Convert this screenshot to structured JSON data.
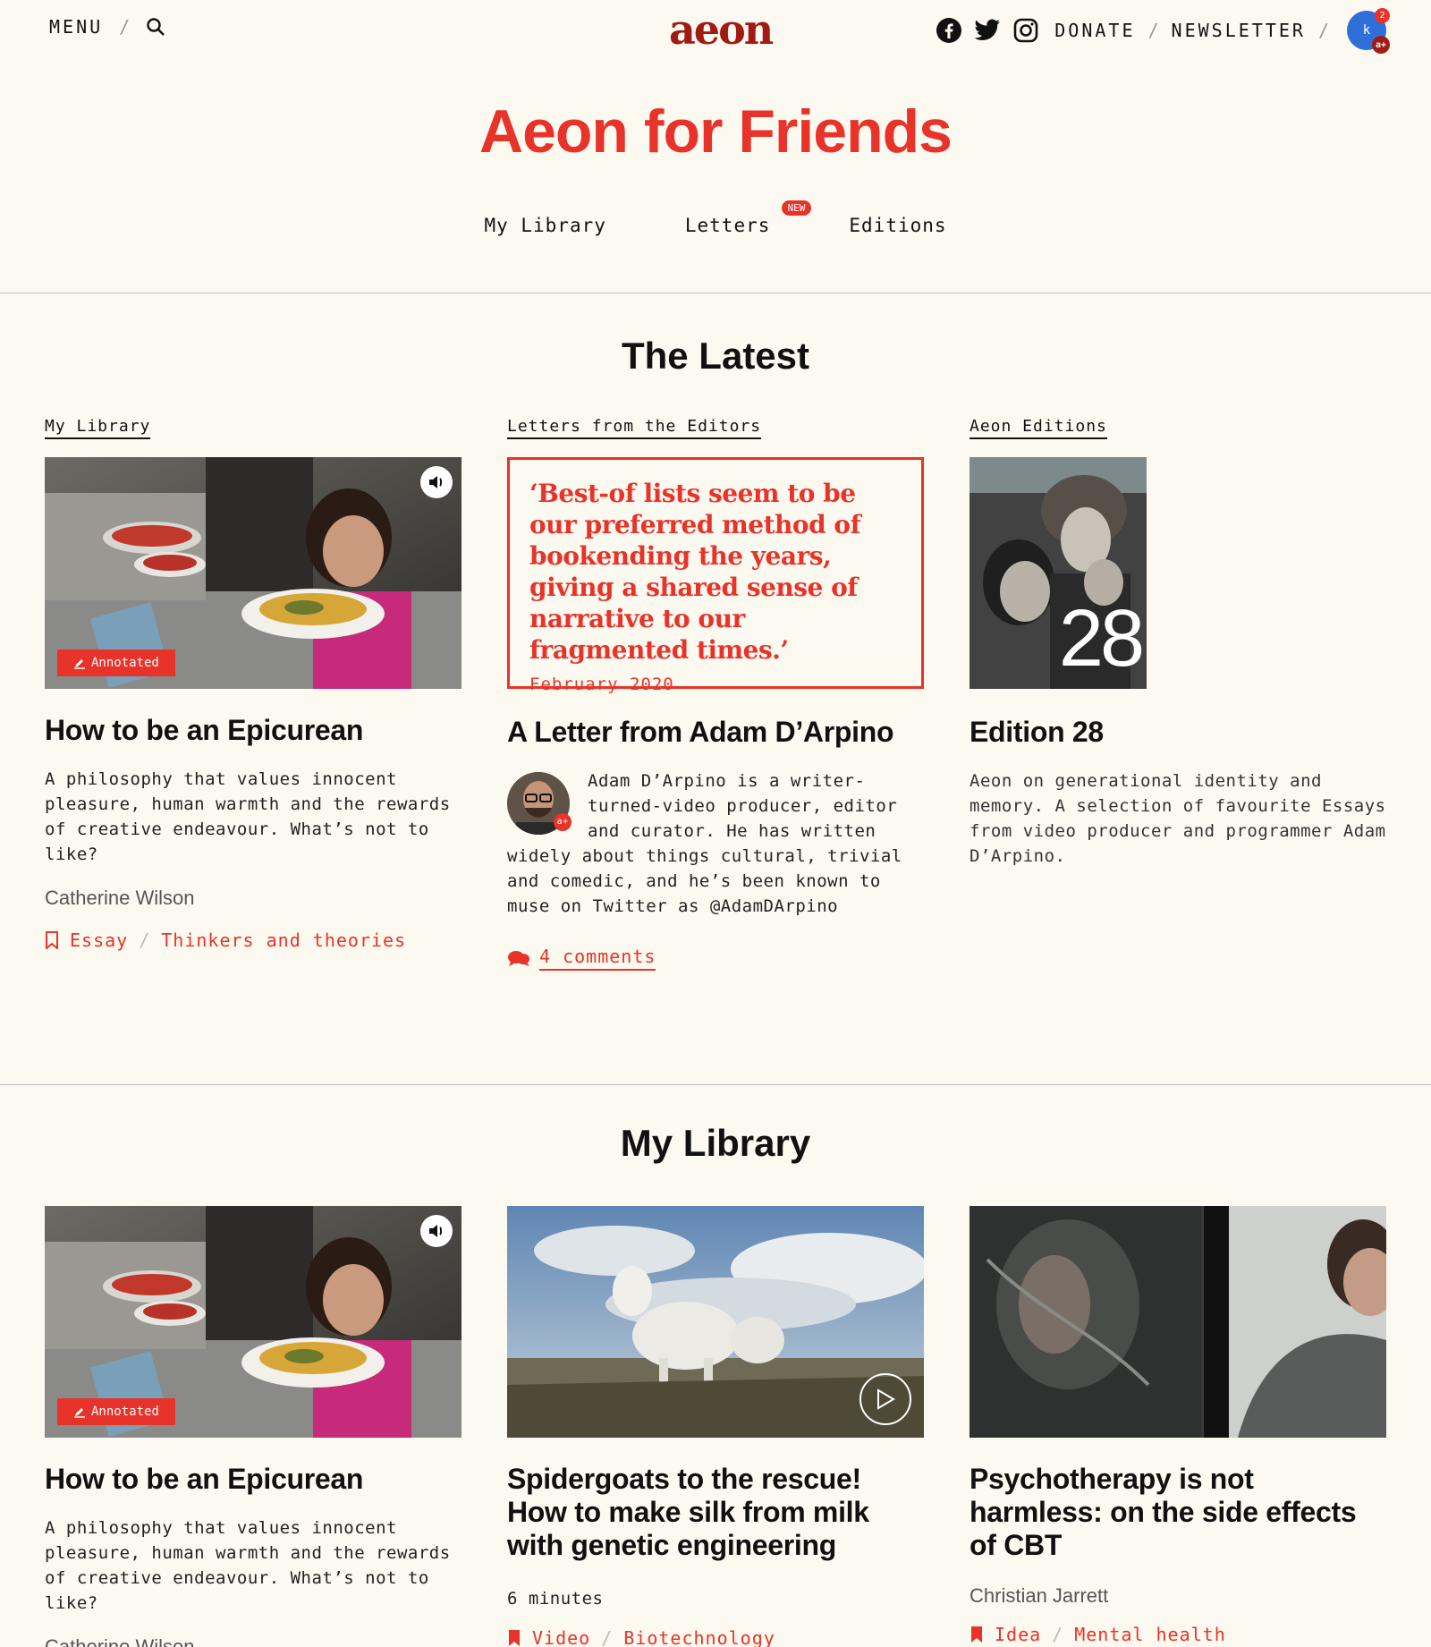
{
  "header": {
    "menu_label": "MENU",
    "logo_text": "aeon",
    "donate_label": "DONATE",
    "newsletter_label": "NEWSLETTER",
    "avatar_initials": "k",
    "notification_count": "2",
    "membership_badge": "a+"
  },
  "hero": {
    "title": "Aeon for Friends"
  },
  "subnav": {
    "tabs": [
      {
        "label": "My Library"
      },
      {
        "label": "Letters",
        "badge": "NEW"
      },
      {
        "label": "Editions"
      }
    ]
  },
  "latest": {
    "title": "The Latest",
    "columns": [
      {
        "label": "My Library",
        "badge": "Annotated",
        "title": "How to be an Epicurean",
        "description": "A philosophy that values innocent pleasure, human warmth and the rewards of creative endeavour. What’s not to like?",
        "author": "Catherine Wilson",
        "tags": [
          "Essay",
          "Thinkers and theories"
        ]
      },
      {
        "label": "Letters from the Editors",
        "quote": "‘Best-of lists seem to be our preferred method of bookending the years, giving a shared sense of narrative to our fragmented times.’",
        "quote_date": "February 2020",
        "title": "A Letter from Adam D’Arpino",
        "body": "Adam D’Arpino is a writer-turned-video producer, editor and curator. He has written widely about things cultural, trivial and comedic, and he’s been known to muse on Twitter as @AdamDArpino",
        "comments": "4 comments",
        "portrait_badge": "a+"
      },
      {
        "label": "Aeon Editions",
        "edition_number": "28",
        "title": "Edition 28",
        "description": "Aeon on generational identity and memory. A selection of favourite Essays from video producer and programmer Adam D’Arpino."
      }
    ]
  },
  "library": {
    "title": "My Library",
    "cards": [
      {
        "badge": "Annotated",
        "title": "How to be an Epicurean",
        "description": "A philosophy that values innocent pleasure, human warmth and the rewards of creative endeavour. What’s not to like?",
        "author": "Catherine Wilson"
      },
      {
        "title": "Spidergoats to the rescue! How to make silk from milk with genetic engineering",
        "duration": "6 minutes",
        "tags": [
          "Video",
          "Biotechnology"
        ]
      },
      {
        "title": "Psychotherapy is not harmless: on the side effects of CBT",
        "author": "Christian Jarrett",
        "tags": [
          "Idea",
          "Mental health"
        ]
      }
    ]
  },
  "colors": {
    "accent": "#e8332a",
    "logo": "#a11a14",
    "background": "#fcfaf0"
  }
}
